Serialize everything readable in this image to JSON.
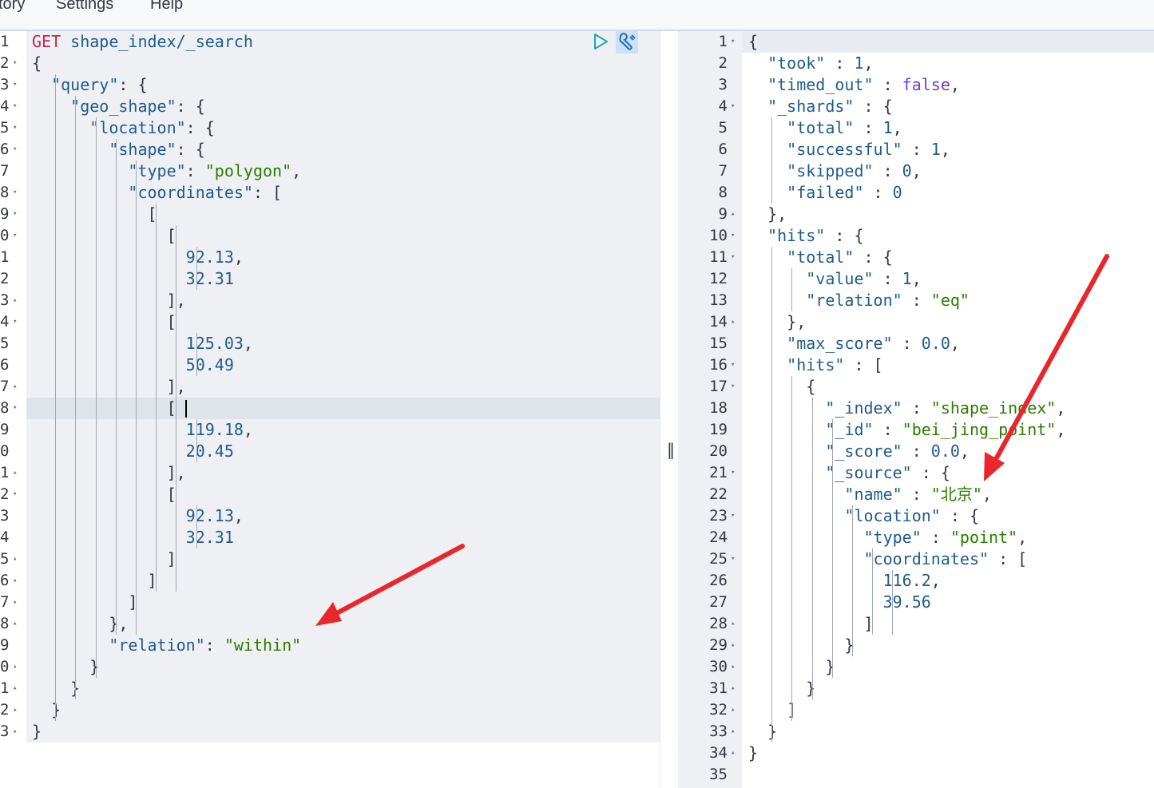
{
  "menu": [
    "tory",
    "Settings",
    "Help"
  ],
  "left_editor": {
    "lines": [
      {
        "n": "1",
        "fold": "",
        "tokens": [
          [
            "m",
            "GET"
          ],
          [
            "p",
            " "
          ],
          [
            "k",
            "shape_index/_search"
          ]
        ]
      },
      {
        "n": "2",
        "fold": "▾",
        "tokens": [
          [
            "p",
            "{"
          ]
        ]
      },
      {
        "n": "3",
        "fold": "▾",
        "tokens": [
          [
            "p",
            "  "
          ],
          [
            "k",
            "\"query\""
          ],
          [
            "p",
            ": {"
          ]
        ]
      },
      {
        "n": "4",
        "fold": "▾",
        "tokens": [
          [
            "p",
            "    "
          ],
          [
            "k",
            "\"geo_shape\""
          ],
          [
            "p",
            ": {"
          ]
        ]
      },
      {
        "n": "5",
        "fold": "▾",
        "tokens": [
          [
            "p",
            "      "
          ],
          [
            "k",
            "\"location\""
          ],
          [
            "p",
            ": {"
          ]
        ]
      },
      {
        "n": "6",
        "fold": "▾",
        "tokens": [
          [
            "p",
            "        "
          ],
          [
            "k",
            "\"shape\""
          ],
          [
            "p",
            ": {"
          ]
        ]
      },
      {
        "n": "7",
        "fold": "",
        "tokens": [
          [
            "p",
            "          "
          ],
          [
            "k",
            "\"type\""
          ],
          [
            "p",
            ": "
          ],
          [
            "s",
            "\"polygon\""
          ],
          [
            "p",
            ","
          ]
        ]
      },
      {
        "n": "8",
        "fold": "▾",
        "tokens": [
          [
            "p",
            "          "
          ],
          [
            "k",
            "\"coordinates\""
          ],
          [
            "p",
            ": ["
          ]
        ]
      },
      {
        "n": "9",
        "fold": "▾",
        "tokens": [
          [
            "p",
            "            ["
          ]
        ]
      },
      {
        "n": "0",
        "fold": "▾",
        "tokens": [
          [
            "p",
            "              ["
          ]
        ]
      },
      {
        "n": "1",
        "fold": "",
        "tokens": [
          [
            "p",
            "                "
          ],
          [
            "n",
            "92.13"
          ],
          [
            "p",
            ","
          ]
        ]
      },
      {
        "n": "2",
        "fold": "",
        "tokens": [
          [
            "p",
            "                "
          ],
          [
            "n",
            "32.31"
          ]
        ]
      },
      {
        "n": "3",
        "fold": "▴",
        "tokens": [
          [
            "p",
            "              ],"
          ]
        ]
      },
      {
        "n": "4",
        "fold": "▾",
        "tokens": [
          [
            "p",
            "              ["
          ]
        ]
      },
      {
        "n": "5",
        "fold": "",
        "tokens": [
          [
            "p",
            "                "
          ],
          [
            "n",
            "125.03"
          ],
          [
            "p",
            ","
          ]
        ]
      },
      {
        "n": "6",
        "fold": "",
        "tokens": [
          [
            "p",
            "                "
          ],
          [
            "n",
            "50.49"
          ]
        ]
      },
      {
        "n": "7",
        "fold": "▴",
        "tokens": [
          [
            "p",
            "              ],"
          ]
        ]
      },
      {
        "n": "8",
        "fold": "▾",
        "tokens": [
          [
            "p",
            "              ["
          ]
        ]
      },
      {
        "n": "9",
        "fold": "",
        "tokens": [
          [
            "p",
            "                "
          ],
          [
            "n",
            "119.18"
          ],
          [
            "p",
            ","
          ]
        ]
      },
      {
        "n": "0",
        "fold": "",
        "tokens": [
          [
            "p",
            "                "
          ],
          [
            "n",
            "20.45"
          ]
        ]
      },
      {
        "n": "1",
        "fold": "▴",
        "tokens": [
          [
            "p",
            "              ],"
          ]
        ]
      },
      {
        "n": "2",
        "fold": "▾",
        "tokens": [
          [
            "p",
            "              ["
          ]
        ]
      },
      {
        "n": "3",
        "fold": "",
        "tokens": [
          [
            "p",
            "                "
          ],
          [
            "n",
            "92.13"
          ],
          [
            "p",
            ","
          ]
        ]
      },
      {
        "n": "4",
        "fold": "",
        "tokens": [
          [
            "p",
            "                "
          ],
          [
            "n",
            "32.31"
          ]
        ]
      },
      {
        "n": "5",
        "fold": "▴",
        "tokens": [
          [
            "p",
            "              ]"
          ]
        ]
      },
      {
        "n": "6",
        "fold": "▴",
        "tokens": [
          [
            "p",
            "            ]"
          ]
        ]
      },
      {
        "n": "7",
        "fold": "▴",
        "tokens": [
          [
            "p",
            "          ]"
          ]
        ]
      },
      {
        "n": "8",
        "fold": "▴",
        "tokens": [
          [
            "p",
            "        },"
          ]
        ]
      },
      {
        "n": "9",
        "fold": "",
        "tokens": [
          [
            "p",
            "        "
          ],
          [
            "k",
            "\"relation\""
          ],
          [
            "p",
            ": "
          ],
          [
            "s",
            "\"within\""
          ]
        ]
      },
      {
        "n": "0",
        "fold": "▴",
        "tokens": [
          [
            "p",
            "      }"
          ]
        ]
      },
      {
        "n": "1",
        "fold": "▴",
        "tokens": [
          [
            "p",
            "    }"
          ]
        ]
      },
      {
        "n": "2",
        "fold": "▴",
        "tokens": [
          [
            "p",
            "  }"
          ]
        ]
      },
      {
        "n": "3",
        "fold": "▴",
        "tokens": [
          [
            "p",
            "}"
          ]
        ]
      }
    ]
  },
  "right_editor": {
    "lines": [
      {
        "n": "1",
        "fold": "▾",
        "tokens": [
          [
            "p",
            "{"
          ]
        ]
      },
      {
        "n": "2",
        "fold": "",
        "tokens": [
          [
            "p",
            "  "
          ],
          [
            "k",
            "\"took\""
          ],
          [
            "p",
            " : "
          ],
          [
            "n",
            "1"
          ],
          [
            "p",
            ","
          ]
        ]
      },
      {
        "n": "3",
        "fold": "",
        "tokens": [
          [
            "p",
            "  "
          ],
          [
            "k",
            "\"timed_out\""
          ],
          [
            "p",
            " : "
          ],
          [
            "b",
            "false"
          ],
          [
            "p",
            ","
          ]
        ]
      },
      {
        "n": "4",
        "fold": "▾",
        "tokens": [
          [
            "p",
            "  "
          ],
          [
            "k",
            "\"_shards\""
          ],
          [
            "p",
            " : {"
          ]
        ]
      },
      {
        "n": "5",
        "fold": "",
        "tokens": [
          [
            "p",
            "    "
          ],
          [
            "k",
            "\"total\""
          ],
          [
            "p",
            " : "
          ],
          [
            "n",
            "1"
          ],
          [
            "p",
            ","
          ]
        ]
      },
      {
        "n": "6",
        "fold": "",
        "tokens": [
          [
            "p",
            "    "
          ],
          [
            "k",
            "\"successful\""
          ],
          [
            "p",
            " : "
          ],
          [
            "n",
            "1"
          ],
          [
            "p",
            ","
          ]
        ]
      },
      {
        "n": "7",
        "fold": "",
        "tokens": [
          [
            "p",
            "    "
          ],
          [
            "k",
            "\"skipped\""
          ],
          [
            "p",
            " : "
          ],
          [
            "n",
            "0"
          ],
          [
            "p",
            ","
          ]
        ]
      },
      {
        "n": "8",
        "fold": "",
        "tokens": [
          [
            "p",
            "    "
          ],
          [
            "k",
            "\"failed\""
          ],
          [
            "p",
            " : "
          ],
          [
            "n",
            "0"
          ]
        ]
      },
      {
        "n": "9",
        "fold": "▴",
        "tokens": [
          [
            "p",
            "  },"
          ]
        ]
      },
      {
        "n": "10",
        "fold": "▾",
        "tokens": [
          [
            "p",
            "  "
          ],
          [
            "k",
            "\"hits\""
          ],
          [
            "p",
            " : {"
          ]
        ]
      },
      {
        "n": "11",
        "fold": "▾",
        "tokens": [
          [
            "p",
            "    "
          ],
          [
            "k",
            "\"total\""
          ],
          [
            "p",
            " : {"
          ]
        ]
      },
      {
        "n": "12",
        "fold": "",
        "tokens": [
          [
            "p",
            "      "
          ],
          [
            "k",
            "\"value\""
          ],
          [
            "p",
            " : "
          ],
          [
            "n",
            "1"
          ],
          [
            "p",
            ","
          ]
        ]
      },
      {
        "n": "13",
        "fold": "",
        "tokens": [
          [
            "p",
            "      "
          ],
          [
            "k",
            "\"relation\""
          ],
          [
            "p",
            " : "
          ],
          [
            "s",
            "\"eq\""
          ]
        ]
      },
      {
        "n": "14",
        "fold": "▴",
        "tokens": [
          [
            "p",
            "    },"
          ]
        ]
      },
      {
        "n": "15",
        "fold": "",
        "tokens": [
          [
            "p",
            "    "
          ],
          [
            "k",
            "\"max_score\""
          ],
          [
            "p",
            " : "
          ],
          [
            "n",
            "0.0"
          ],
          [
            "p",
            ","
          ]
        ]
      },
      {
        "n": "16",
        "fold": "▾",
        "tokens": [
          [
            "p",
            "    "
          ],
          [
            "k",
            "\"hits\""
          ],
          [
            "p",
            " : ["
          ]
        ]
      },
      {
        "n": "17",
        "fold": "▾",
        "tokens": [
          [
            "p",
            "      {"
          ]
        ]
      },
      {
        "n": "18",
        "fold": "",
        "tokens": [
          [
            "p",
            "        "
          ],
          [
            "k",
            "\"_index\""
          ],
          [
            "p",
            " : "
          ],
          [
            "s",
            "\"shape_index\""
          ],
          [
            "p",
            ","
          ]
        ]
      },
      {
        "n": "19",
        "fold": "",
        "tokens": [
          [
            "p",
            "        "
          ],
          [
            "k",
            "\"_id\""
          ],
          [
            "p",
            " : "
          ],
          [
            "s",
            "\"bei_jing_point\""
          ],
          [
            "p",
            ","
          ]
        ]
      },
      {
        "n": "20",
        "fold": "",
        "tokens": [
          [
            "p",
            "        "
          ],
          [
            "k",
            "\"_score\""
          ],
          [
            "p",
            " : "
          ],
          [
            "n",
            "0.0"
          ],
          [
            "p",
            ","
          ]
        ]
      },
      {
        "n": "21",
        "fold": "▾",
        "tokens": [
          [
            "p",
            "        "
          ],
          [
            "k",
            "\"_source\""
          ],
          [
            "p",
            " : {"
          ]
        ]
      },
      {
        "n": "22",
        "fold": "",
        "tokens": [
          [
            "p",
            "          "
          ],
          [
            "k",
            "\"name\""
          ],
          [
            "p",
            " : "
          ],
          [
            "s",
            "\"北京\""
          ],
          [
            "p",
            ","
          ]
        ]
      },
      {
        "n": "23",
        "fold": "▾",
        "tokens": [
          [
            "p",
            "          "
          ],
          [
            "k",
            "\"location\""
          ],
          [
            "p",
            " : {"
          ]
        ]
      },
      {
        "n": "24",
        "fold": "",
        "tokens": [
          [
            "p",
            "            "
          ],
          [
            "k",
            "\"type\""
          ],
          [
            "p",
            " : "
          ],
          [
            "s",
            "\"point\""
          ],
          [
            "p",
            ","
          ]
        ]
      },
      {
        "n": "25",
        "fold": "▾",
        "tokens": [
          [
            "p",
            "            "
          ],
          [
            "k",
            "\"coordinates\""
          ],
          [
            "p",
            " : ["
          ]
        ]
      },
      {
        "n": "26",
        "fold": "",
        "tokens": [
          [
            "p",
            "              "
          ],
          [
            "n",
            "116.2"
          ],
          [
            "p",
            ","
          ]
        ]
      },
      {
        "n": "27",
        "fold": "",
        "tokens": [
          [
            "p",
            "              "
          ],
          [
            "n",
            "39.56"
          ]
        ]
      },
      {
        "n": "28",
        "fold": "▴",
        "tokens": [
          [
            "p",
            "            ]"
          ]
        ]
      },
      {
        "n": "29",
        "fold": "▴",
        "tokens": [
          [
            "p",
            "          }"
          ]
        ]
      },
      {
        "n": "30",
        "fold": "▴",
        "tokens": [
          [
            "p",
            "        }"
          ]
        ]
      },
      {
        "n": "31",
        "fold": "▴",
        "tokens": [
          [
            "p",
            "      }"
          ]
        ]
      },
      {
        "n": "32",
        "fold": "▴",
        "tokens": [
          [
            "p",
            "    ]"
          ]
        ]
      },
      {
        "n": "33",
        "fold": "▴",
        "tokens": [
          [
            "p",
            "  }"
          ]
        ]
      },
      {
        "n": "34",
        "fold": "▴",
        "tokens": [
          [
            "p",
            "}"
          ]
        ]
      },
      {
        "n": "35",
        "fold": "",
        "tokens": []
      }
    ]
  },
  "icons": {
    "run": "play-icon",
    "settings": "wrench-icon",
    "splitter": "resize-grip-icon",
    "annotation": "red-arrow-annotation"
  },
  "colors": {
    "key": "#1f5b8c",
    "string": "#2a7d00",
    "number": "#1f5b8c",
    "boolean": "#6b3fd1",
    "method": "#c7254e",
    "annotation_arrow": "#e8262b"
  }
}
